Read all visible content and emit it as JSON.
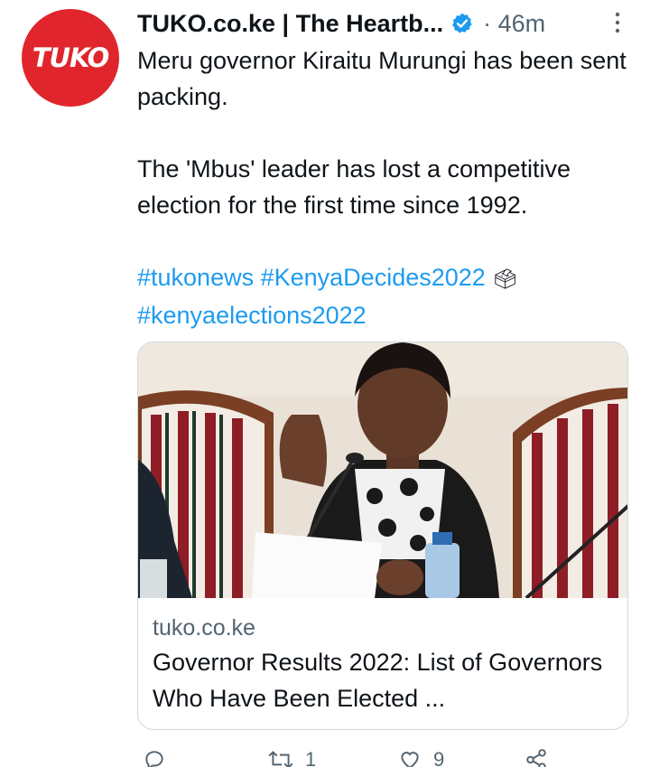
{
  "tweet": {
    "avatar_text": "TUKO",
    "display_name": "TUKO.co.ke | The Heartb...",
    "time_separator": "·",
    "time": "46m",
    "text_line1": "Meru governor Kiraitu Murungi has been sent packing.",
    "text_line2": "The 'Mbus' leader has lost a competitive election for the first time since 1992.",
    "hashtags": [
      "#tukonews",
      "#KenyaDecides2022",
      "#kenyaelections2022"
    ],
    "emoji": "🗳"
  },
  "card": {
    "domain": "tuko.co.ke",
    "title": "Governor Results 2022: List of Governors Who Have Been Elected ..."
  },
  "actions": {
    "reply_count": "",
    "retweet_count": "1",
    "like_count": "9",
    "share_count": ""
  },
  "colors": {
    "brand_red": "#e0262c",
    "link_blue": "#1d9bf0",
    "muted": "#536471"
  }
}
